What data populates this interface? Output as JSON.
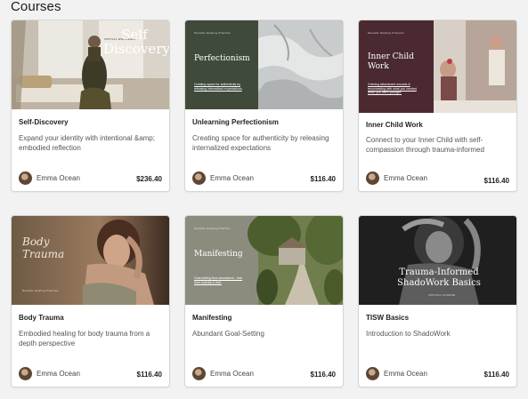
{
  "page": {
    "heading": "Courses"
  },
  "courses": [
    {
      "title": "Self-Discovery",
      "description": "Expand your identity with intentional &amp; embodied reflection",
      "instructor": "Emma Ocean",
      "price": "$236.40",
      "thumb_title": "Self Discovery",
      "thumb_small": "VIRTUAL WORKSHOP"
    },
    {
      "title": "Unlearning Perfectionism",
      "description": "Creating space for authenticity by releasing internalized expectations",
      "instructor": "Emma Ocean",
      "price": "$116.40",
      "thumb_title": "Perfectionism",
      "thumb_small": "Somatic Healing Practice",
      "thumb_sub": "Creating space for authenticity by releasing internalized expectations"
    },
    {
      "title": "Inner Child Work",
      "description": "Connect to your Inner Child with self-compassion through trauma-informed",
      "instructor": "Emma Ocean",
      "price": "$116.40",
      "thumb_title": "Inner Child Work",
      "thumb_small": "Somatic Healing Practice",
      "thumb_sub": "Grieving attachment wounds & reconnecting with what you needed when you were younger."
    },
    {
      "title": "Body Trauma",
      "description": "Embodied healing for body trauma from a depth perspective",
      "instructor": "Emma Ocean",
      "price": "$116.40",
      "thumb_title": "Body Trauma",
      "thumb_small": "Somatic Healing Practice"
    },
    {
      "title": "Manifesting",
      "description": "Abundant Goal-Setting",
      "instructor": "Emma Ocean",
      "price": "$116.40",
      "thumb_title": "Manifesting",
      "thumb_small": "Somatic Healing Practice",
      "thumb_sub": "Goal setting from abundance - free from scarcity & fear."
    },
    {
      "title": "TISW Basics",
      "description": "Introduction to ShadoWork",
      "instructor": "Emma Ocean",
      "price": "$116.40",
      "thumb_title": "Trauma-Informed ShadoWork Basics",
      "thumb_small": "VIRTUAL COURSE"
    }
  ],
  "colors": {
    "page_bg": "#f2f2f2",
    "perfectionism_panel": "#3f4a3b",
    "inner_child_panel": "#4a2a30",
    "manifesting_panel": "#8c8c7e"
  }
}
